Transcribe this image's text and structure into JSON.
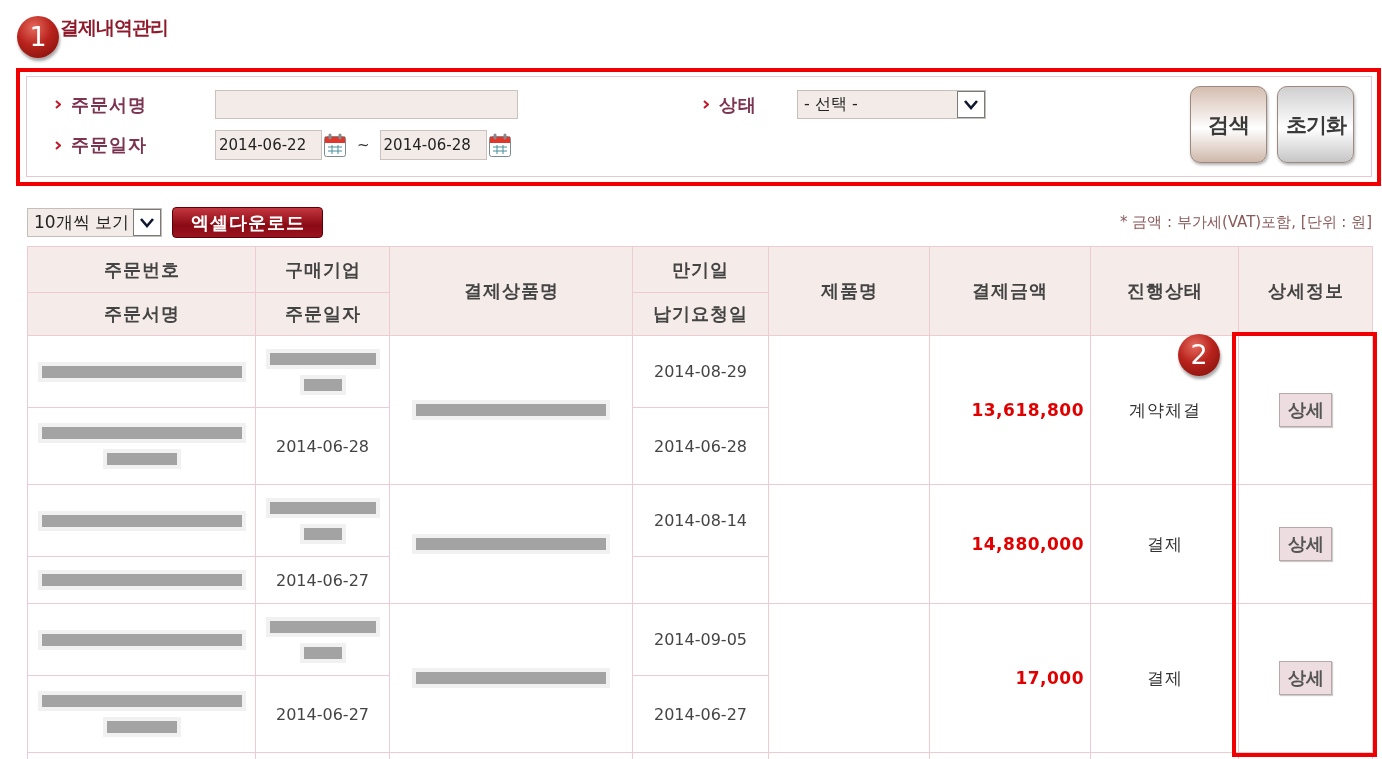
{
  "page": {
    "title": "결제내역관리"
  },
  "callouts": [
    {
      "number": "1"
    },
    {
      "number": "2"
    }
  ],
  "search_panel": {
    "order_name": {
      "label": "주문서명"
    },
    "order_date": {
      "label": "주문일자",
      "from": "2014-06-22",
      "separator": "~",
      "to": "2014-06-28"
    },
    "status": {
      "label": "상태",
      "value": "- 선택 -"
    },
    "buttons": [
      {
        "label": "검색",
        "kind": "search"
      },
      {
        "label": "초기화",
        "kind": "reset"
      }
    ]
  },
  "toolbar": {
    "page_size": "10개씩 보기",
    "excel_button": "엑셀다운로드",
    "note": "* 금액 : 부가세(VAT)포함, [단위 : 원]"
  },
  "table": {
    "columns": [
      {
        "top": "주문번호",
        "bottom": "주문서명"
      },
      {
        "top": "구매기업",
        "bottom": "주문일자"
      },
      {
        "label": "결제상품명"
      },
      {
        "top": "만기일",
        "bottom": "납기요청일"
      },
      {
        "label": "제품명"
      },
      {
        "label": "결제금액"
      },
      {
        "label": "진행상태"
      },
      {
        "label": "상세정보"
      }
    ],
    "rows": [
      {
        "order_number": {
          "redacted_bars": [
            {
              "kind": "long"
            }
          ]
        },
        "order_name": {
          "redacted_bars": [
            {
              "kind": "long"
            },
            {
              "kind": "short"
            }
          ]
        },
        "buyer": {
          "redacted_bars": [
            {
              "kind": "long"
            },
            {
              "kind": "short"
            }
          ]
        },
        "order_date": "2014-06-28",
        "product": {
          "redacted_bars": [
            {
              "kind": "long"
            }
          ]
        },
        "due_date": "2014-08-29",
        "requested_date": "2014-06-28",
        "amount": "13,618,800",
        "status": "계약체결",
        "detail_button": "상세"
      },
      {
        "order_number": {
          "redacted_bars": [
            {
              "kind": "long"
            }
          ]
        },
        "order_name": {
          "redacted_bars": [
            {
              "kind": "long"
            }
          ]
        },
        "buyer": {
          "redacted_bars": [
            {
              "kind": "long"
            },
            {
              "kind": "short"
            }
          ]
        },
        "order_date": "2014-06-27",
        "product": {
          "redacted_bars": [
            {
              "kind": "long"
            }
          ]
        },
        "due_date": "2014-08-14",
        "amount": "14,880,000",
        "status": "결제",
        "detail_button": "상세"
      },
      {
        "order_number": {
          "redacted_bars": [
            {
              "kind": "long"
            }
          ]
        },
        "order_name": {
          "redacted_bars": [
            {
              "kind": "long"
            },
            {
              "kind": "short"
            }
          ]
        },
        "buyer": {
          "redacted_bars": [
            {
              "kind": "long"
            },
            {
              "kind": "short"
            }
          ]
        },
        "order_date": "2014-06-27",
        "product": {
          "redacted_bars": [
            {
              "kind": "long"
            }
          ]
        },
        "due_date": "2014-09-05",
        "requested_date": "2014-06-27",
        "amount": "17,000",
        "status": "결제",
        "detail_button": "상세"
      }
    ]
  }
}
